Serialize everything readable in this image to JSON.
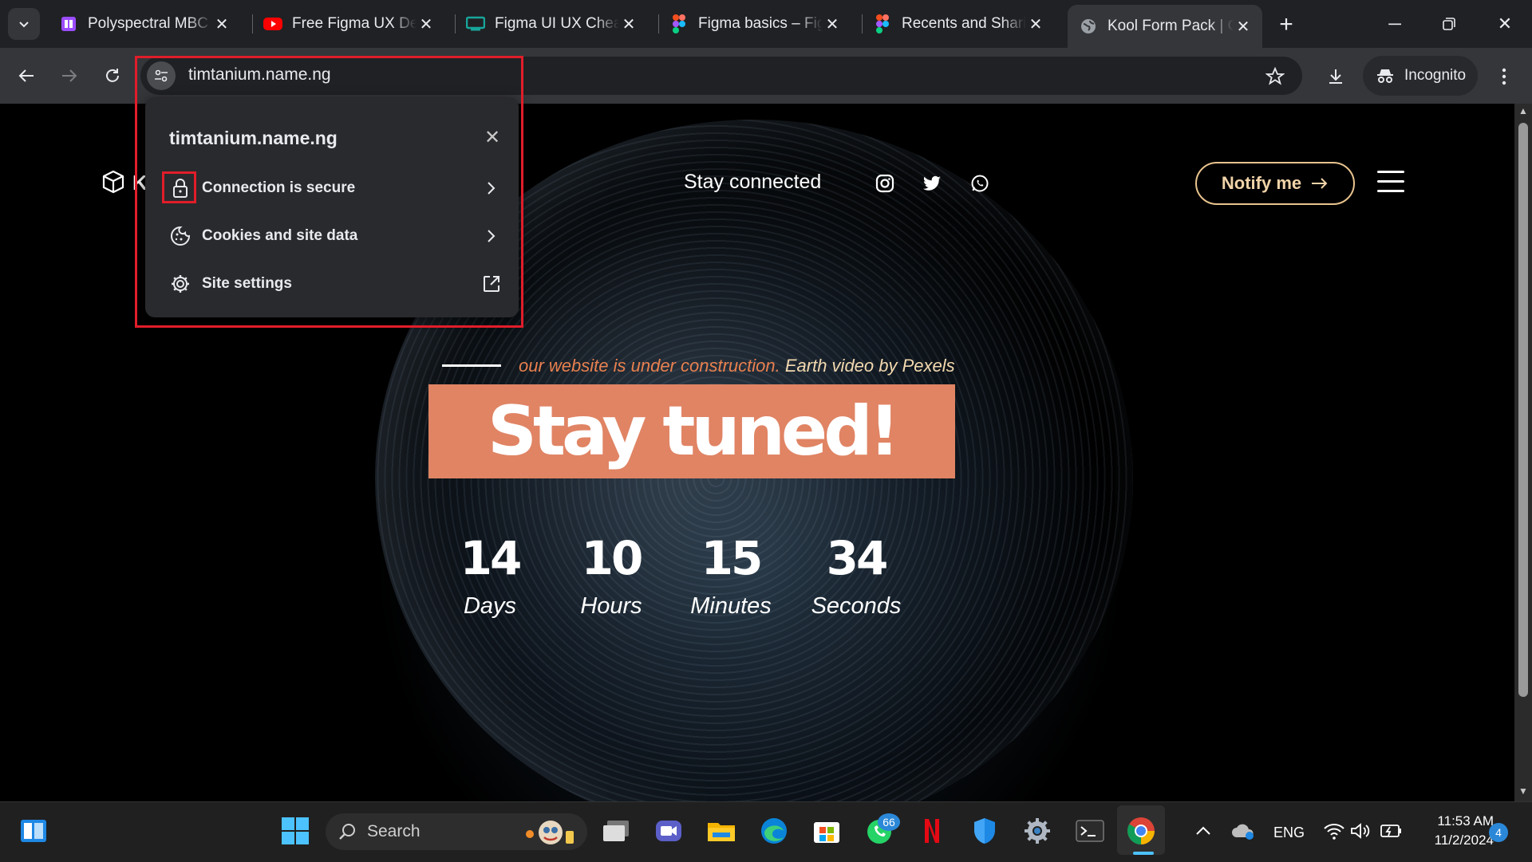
{
  "browser": {
    "tabs": [
      {
        "title": "Polyspectral MBC |",
        "icon": "polyspectral-icon",
        "color": "#9b4dff"
      },
      {
        "title": "Free Figma UX Des",
        "icon": "youtube-icon",
        "color": "#ff0000"
      },
      {
        "title": "Figma UI UX Cheat",
        "icon": "monitor-icon",
        "color": "#17a69b"
      },
      {
        "title": "Figma basics – Figm",
        "icon": "figma-icon",
        "color": "#f24e1e"
      },
      {
        "title": "Recents and Sharin",
        "icon": "figma-icon",
        "color": "#f24e1e"
      },
      {
        "title": "Kool Form Pack | C",
        "icon": "globe-icon",
        "color": "#9aa0a6",
        "active": true
      }
    ],
    "url": "timtanium.name.ng",
    "incognito_label": "Incognito"
  },
  "site_info_popup": {
    "title": "timtanium.name.ng",
    "items": [
      {
        "label": "Connection is secure",
        "icon": "lock-icon"
      },
      {
        "label": "Cookies and site data",
        "icon": "cookie-icon"
      },
      {
        "label": "Site settings",
        "icon": "gear-icon"
      }
    ],
    "highlight_color": "#e11d2a"
  },
  "website": {
    "logo_letter": "K",
    "nav_text": "Stay connected",
    "social": [
      "instagram-icon",
      "twitter-icon",
      "whatsapp-icon"
    ],
    "notify_label": "Notify me",
    "subtitle_orange": "our website is under construction.",
    "subtitle_white": "Earth video by Pexels",
    "headline": "Stay tuned!",
    "countdown": [
      {
        "value": "14",
        "label": "Days"
      },
      {
        "value": "10",
        "label": "Hours"
      },
      {
        "value": "15",
        "label": "Minutes"
      },
      {
        "value": "34",
        "label": "Seconds"
      }
    ],
    "colors": {
      "accent": "#e08464",
      "button_border": "#e9c48f"
    }
  },
  "taskbar": {
    "search_label": "Search",
    "whatsapp_badge": "66",
    "language": "ENG",
    "time": "11:53 AM",
    "date": "11/2/2024",
    "notification_count": "4"
  }
}
